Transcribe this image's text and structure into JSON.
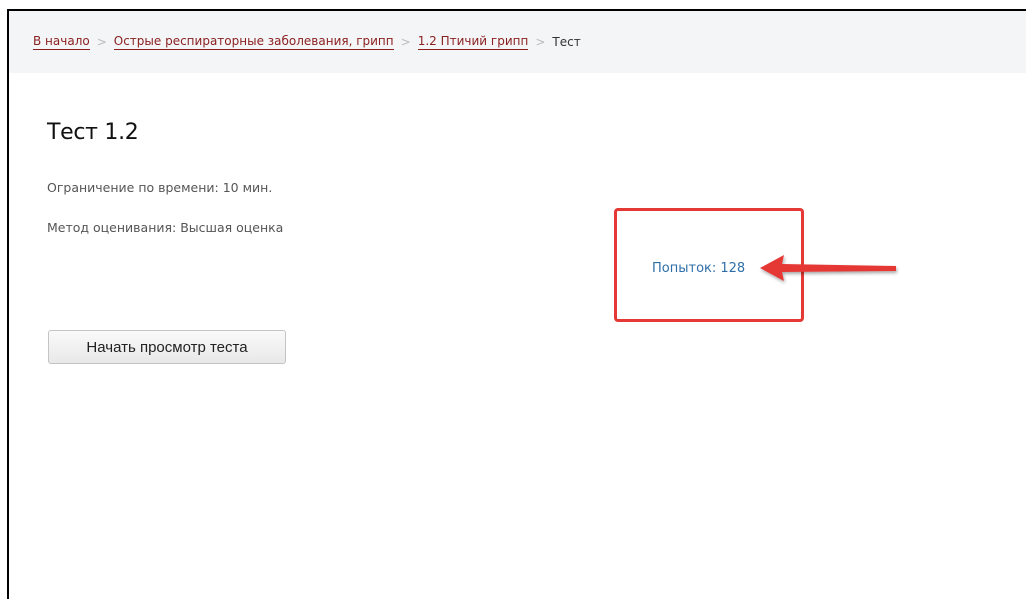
{
  "breadcrumb": {
    "items": [
      {
        "label": "В начало"
      },
      {
        "label": "Острые респираторные заболевания, грипп"
      },
      {
        "label": "1.2 Птичий грипп"
      }
    ],
    "current": "Тест",
    "separator": ">"
  },
  "quiz": {
    "title": "Тест 1.2",
    "time_limit": "Ограничение по времени: 10 мин.",
    "grading_method": "Метод оценивания: Высшая оценка",
    "attempts": "Попыток: 128",
    "start_button_label": "Начать просмотр теста"
  },
  "annotation": {
    "color": "#e53935"
  },
  "colors": {
    "breadcrumb_link": "#8a1f1f",
    "attempts_link": "#2f6fa8"
  }
}
